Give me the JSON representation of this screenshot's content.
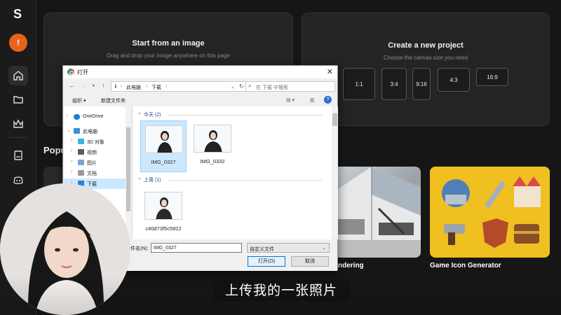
{
  "app": {
    "logo_letter": "S",
    "avatar_letter": "f"
  },
  "sidebar": {
    "icons": [
      "home-icon",
      "folder-icon",
      "crown-icon",
      "book-icon",
      "discord-icon"
    ]
  },
  "start_card": {
    "title": "Start from an image",
    "subtitle": "Drag and drop your image anywhere on this page"
  },
  "create_card": {
    "title": "Create a new project",
    "subtitle": "Choose the canvas size you need",
    "ratios": [
      "1:1",
      "3:4",
      "9:16",
      "4:3",
      "16:9"
    ]
  },
  "popular": {
    "heading": "Popu",
    "tiles": [
      {
        "label": "ndering"
      },
      {
        "label": "Game Icon Generator"
      }
    ]
  },
  "dialog": {
    "title": "打开",
    "path": [
      "此电脑",
      "下载"
    ],
    "search_placeholder": "在 下载 中搜索",
    "organize": "组织 ▾",
    "new_folder": "新建文件夹",
    "tree": [
      {
        "label": "OneDrive",
        "icon": "cloud-icon"
      },
      {
        "label": "此电脑",
        "icon": "computer-icon"
      },
      {
        "label": "3D 对象",
        "icon": "cube-icon"
      },
      {
        "label": "视频",
        "icon": "video-icon"
      },
      {
        "label": "图片",
        "icon": "picture-icon"
      },
      {
        "label": "文档",
        "icon": "document-icon"
      },
      {
        "label": "下载",
        "icon": "download-icon"
      }
    ],
    "groups": [
      {
        "header": "今天 (2)",
        "files": [
          "IMG_0327",
          "IMG_0332"
        ]
      },
      {
        "header": "上周 (1)",
        "files": [
          "c40d73f5c5922"
        ]
      }
    ],
    "file_name_label": "件名(N):",
    "file_name_value": "IMG_0327",
    "file_type": "自定义文件",
    "open_button": "打开(O)",
    "cancel_button": "取消"
  },
  "subtitle": "上传我的一张照片",
  "colors": {
    "accent": "#e8621c",
    "background": "#161616",
    "card": "#242424",
    "selection": "#cce8ff"
  }
}
